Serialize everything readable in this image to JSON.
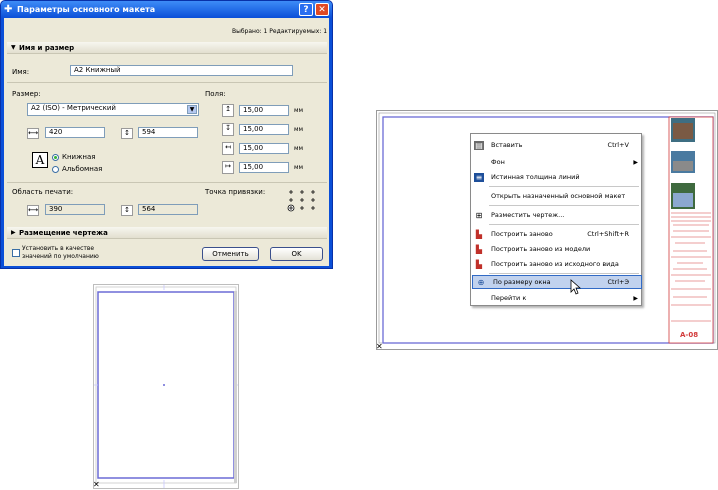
{
  "dialog": {
    "title": "Параметры основного макета",
    "help": "?",
    "close": "✕",
    "selected_info": "Выбрано: 1 Редактируемых: 1",
    "section_name_size": "Имя и размер",
    "name_label": "Имя:",
    "name_value": "A2 Книжный",
    "size_label": "Размер:",
    "size_value": "A2 (ISO) - Метрический",
    "width_value": "420",
    "height_value": "594",
    "orientation_portrait": "Книжная",
    "orientation_landscape": "Альбомная",
    "margins_label": "Поля:",
    "margins": [
      "15,00",
      "15,00",
      "15,00",
      "15,00"
    ],
    "unit": "мм",
    "print_area_label": "Область печати:",
    "print_width": "390",
    "print_height": "564",
    "anchor_label": "Точка привязки:",
    "section_placement": "Размещение чертежа",
    "default_label_line1": "Установить в качестве",
    "default_label_line2": "значений по умолчанию",
    "cancel": "Отменить",
    "ok": "OK"
  },
  "layout": {
    "stamp_text": "A-08"
  },
  "menu": {
    "items": [
      {
        "label": "Вставить",
        "shortcut": "Ctrl+V",
        "icon": "paste-icon"
      },
      {
        "label": "Фон",
        "shortcut": "",
        "icon": "",
        "submenu": true
      },
      {
        "label": "Истинная толщина линий",
        "shortcut": "",
        "icon": "line-weight-icon"
      },
      {
        "label": "Открыть назначенный основной макет",
        "shortcut": "",
        "icon": ""
      },
      {
        "label": "Разместить чертеж...",
        "shortcut": "",
        "icon": "place-drawing-icon"
      },
      {
        "label": "Построить заново",
        "shortcut": "Ctrl+Shift+R",
        "icon": "rebuild-icon"
      },
      {
        "label": "Построить заново из модели",
        "shortcut": "",
        "icon": "rebuild-model-icon"
      },
      {
        "label": "Построить заново из исходного вида",
        "shortcut": "",
        "icon": "rebuild-view-icon"
      },
      {
        "label": "По размеру окна",
        "shortcut": "Ctrl+Э",
        "icon": "fit-window-icon"
      },
      {
        "label": "Перейти к",
        "shortcut": "",
        "icon": "",
        "submenu": true
      }
    ]
  }
}
